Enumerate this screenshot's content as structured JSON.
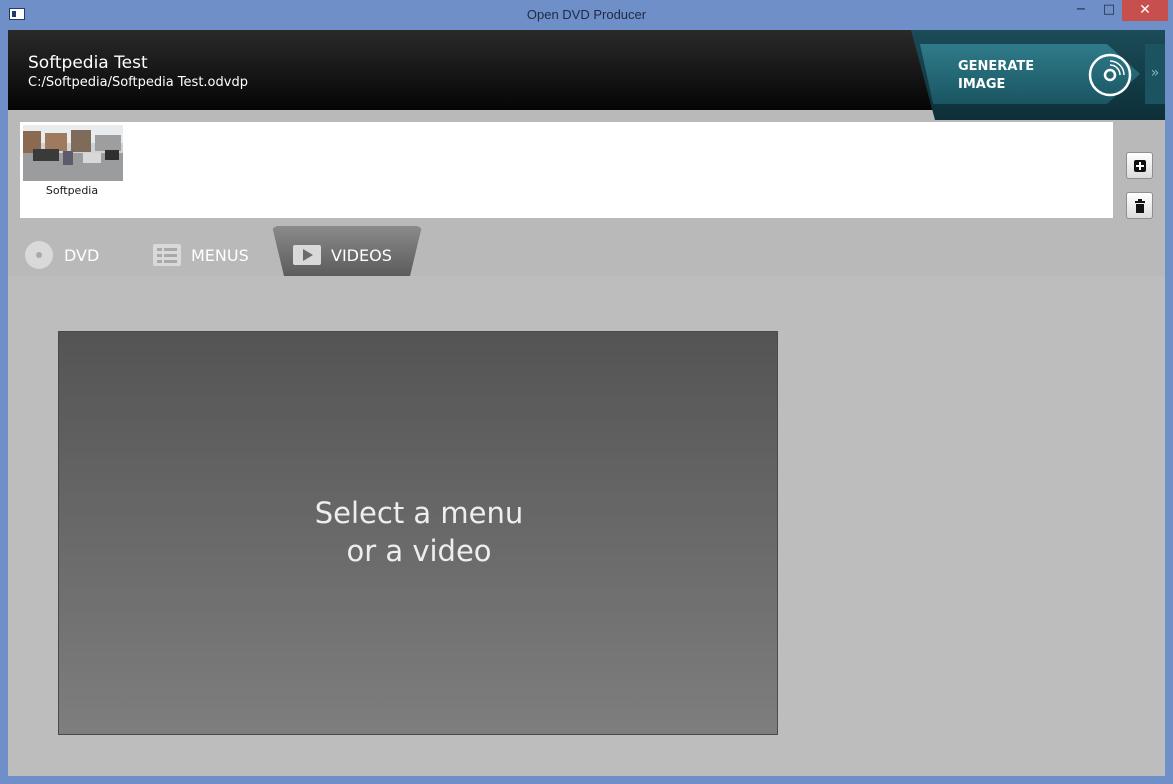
{
  "window": {
    "title": "Open DVD Producer",
    "controls": {
      "minimize": "−",
      "maximize": "□",
      "close": "✕"
    }
  },
  "project": {
    "name": "Softpedia Test",
    "path": "C:/Softpedia/Softpedia Test.odvdp"
  },
  "generate": {
    "label_line1": "GENERATE",
    "label_line2": "IMAGE",
    "icon": "disc-icon",
    "expand": "»"
  },
  "assets": {
    "items": [
      {
        "label": "Softpedia"
      }
    ],
    "add_icon": "add-icon",
    "delete_icon": "trash-icon"
  },
  "tabs": [
    {
      "label": "DVD",
      "icon": "disc-icon",
      "active": false
    },
    {
      "label": "MENUS",
      "icon": "list-icon",
      "active": false
    },
    {
      "label": "VIDEOS",
      "icon": "play-icon",
      "active": true
    }
  ],
  "preview": {
    "line1": "Select a menu",
    "line2": "or a video"
  },
  "colors": {
    "titlebar": "#6e8fc7",
    "header": "#0a0a0a",
    "accent": "#2f7b8a",
    "close": "#c7504f"
  }
}
